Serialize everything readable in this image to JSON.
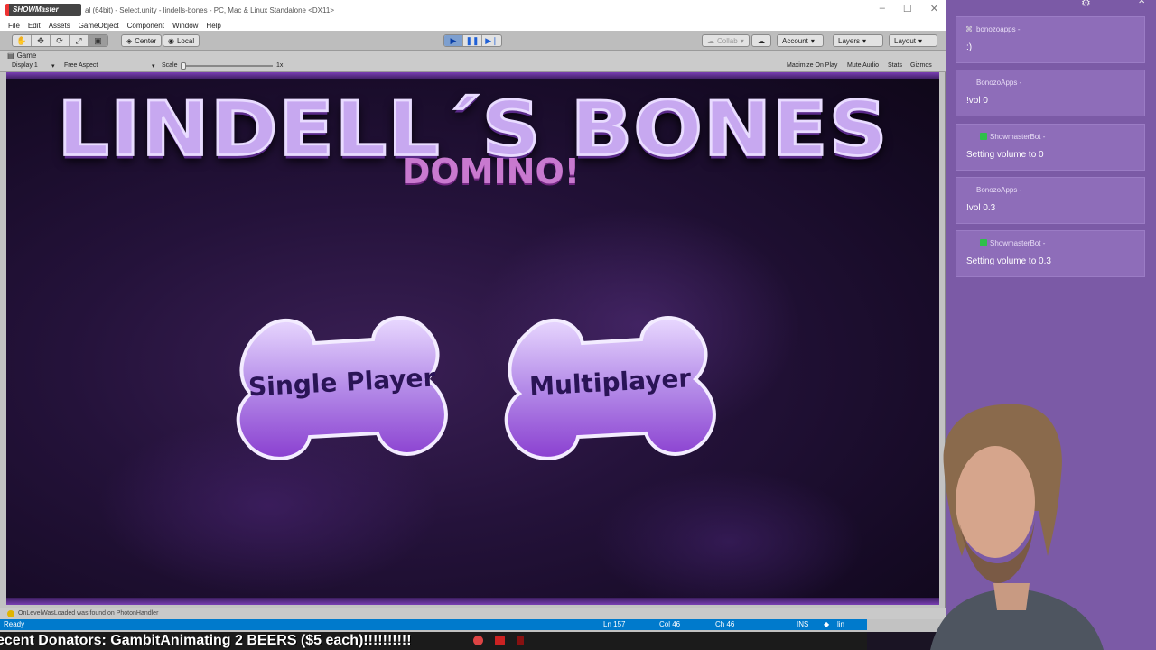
{
  "unity": {
    "window_title": "al (64bit) - Select.unity - lindells-bones - PC, Mac & Linux Standalone <DX11>",
    "window_controls": {
      "minimize": "–",
      "maximize": "☐",
      "close": "✕"
    },
    "menu": [
      "File",
      "Edit",
      "Assets",
      "GameObject",
      "Component",
      "Window",
      "Help"
    ],
    "toolbar": {
      "center_label": "Center",
      "local_label": "Local",
      "collab_label": "Collab",
      "account_label": "Account",
      "layers_label": "Layers",
      "layout_label": "Layout"
    },
    "game_tab": {
      "label": "Game",
      "display": "Display 1",
      "aspect": "Free Aspect",
      "scale_label": "Scale",
      "scale_value": "1x",
      "maximize_on_play": "Maximize On Play",
      "mute_audio": "Mute Audio",
      "stats": "Stats",
      "gizmos": "Gizmos"
    },
    "console_message": "OnLevelWasLoaded was found on PhotonHandler"
  },
  "game": {
    "title": "LINDELL´S BONES",
    "subtitle": "DOMINO!",
    "single_player_label": "Single Player",
    "multiplayer_label": "Multiplayer"
  },
  "editor_status": {
    "ready": "Ready",
    "line": "Ln 157",
    "col": "Col 46",
    "ch": "Ch 46",
    "mode": "INS",
    "extra": "lin"
  },
  "ticker": {
    "text": "ecent Donators: GambitAnimating 2 BEERS ($5 each)!!!!!!!!!!"
  },
  "chat": {
    "messages": [
      {
        "user": "bonozoapps -",
        "text": ":)"
      },
      {
        "user": "BonozoApps -",
        "text": "!vol 0"
      },
      {
        "user": "ShowmasterBot -",
        "text": "Setting volume to 0"
      },
      {
        "user": "BonozoApps -",
        "text": "!vol 0.3"
      },
      {
        "user": "ShowmasterBot -",
        "text": "Setting volume to 0.3"
      }
    ]
  },
  "colors": {
    "chat_bg": "#7b5aa6",
    "chat_msg_bg": "#8e6db9",
    "bone_fill": "#b48be8",
    "vs_status": "#007acc"
  }
}
